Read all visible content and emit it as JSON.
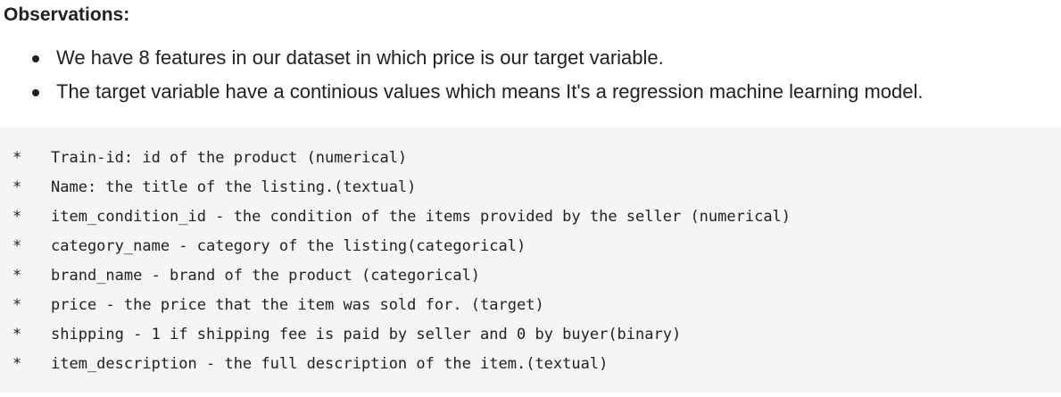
{
  "heading": "Observations:",
  "bullets": [
    "We have 8 features in our dataset in which price is our target variable.",
    "The target variable have a continious values which means It's a regression machine learning model."
  ],
  "code": {
    "marker": "*",
    "lines": [
      "Train-id: id of the product (numerical)",
      "Name: the title of the listing.(textual)",
      "item_condition_id - the condition of the items provided by the seller (numerical)",
      "category_name - category of the listing(categorical)",
      "brand_name - brand of the product (categorical)",
      "price - the price that the item was sold for. (target)",
      "shipping - 1 if shipping fee is paid by seller and 0 by buyer(binary)",
      "item_description - the full description of the item.(textual)"
    ]
  }
}
